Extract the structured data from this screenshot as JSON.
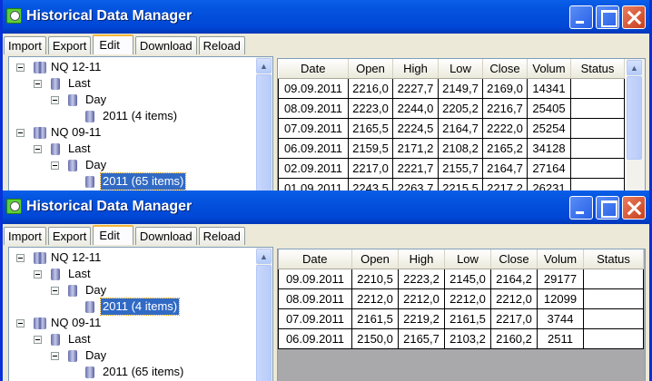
{
  "window_title": "Historical Data Manager",
  "tabs": [
    "Import",
    "Export",
    "Edit",
    "Download",
    "Reload"
  ],
  "active_tab": "Edit",
  "columns": [
    "Date",
    "Open",
    "High",
    "Low",
    "Close",
    "Volum",
    "Status"
  ],
  "tree": [
    {
      "label": "NQ 12-11",
      "level": 0
    },
    {
      "label": "Last",
      "level": 1
    },
    {
      "label": "Day",
      "level": 2
    },
    {
      "label": "2011 (4 items)",
      "level": 3
    },
    {
      "label": "NQ 09-11",
      "level": 0
    },
    {
      "label": "Last",
      "level": 1
    },
    {
      "label": "Day",
      "level": 2
    },
    {
      "label": "2011 (65 items)",
      "level": 3
    }
  ],
  "windows": [
    {
      "selected_node": 7,
      "rows": [
        [
          "09.09.2011",
          "2216,0",
          "2227,7",
          "2149,7",
          "2169,0",
          "14341",
          ""
        ],
        [
          "08.09.2011",
          "2223,0",
          "2244,0",
          "2205,2",
          "2216,7",
          "25405",
          ""
        ],
        [
          "07.09.2011",
          "2165,5",
          "2224,5",
          "2164,7",
          "2222,0",
          "25254",
          ""
        ],
        [
          "06.09.2011",
          "2159,5",
          "2171,2",
          "2108,2",
          "2165,2",
          "34128",
          ""
        ],
        [
          "02.09.2011",
          "2217,0",
          "2221,7",
          "2155,7",
          "2164,7",
          "27164",
          ""
        ],
        [
          "01.09.2011",
          "2243,5",
          "2263,7",
          "2215,5",
          "2217,2",
          "26231",
          ""
        ]
      ]
    },
    {
      "selected_node": 3,
      "rows": [
        [
          "09.09.2011",
          "2210,5",
          "2223,2",
          "2145,0",
          "2164,2",
          "29177",
          ""
        ],
        [
          "08.09.2011",
          "2212,0",
          "2212,0",
          "2212,0",
          "2212,0",
          "12099",
          ""
        ],
        [
          "07.09.2011",
          "2161,5",
          "2219,2",
          "2161,5",
          "2217,0",
          "3744",
          ""
        ],
        [
          "06.09.2011",
          "2150,0",
          "2165,7",
          "2103,2",
          "2160,2",
          "2511",
          ""
        ]
      ]
    }
  ]
}
